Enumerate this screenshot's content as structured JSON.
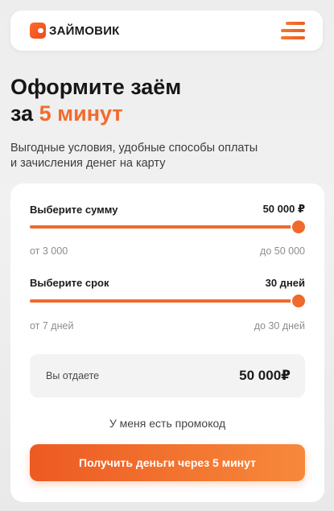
{
  "colors": {
    "accent": "#f26b2b",
    "accent_dark": "#ec4b1c",
    "text": "#1b1b1b",
    "muted": "#8d8d8d",
    "card": "#ffffff",
    "summary_bg": "#f3f3f3"
  },
  "header": {
    "logo_icon": "zaymovik-logo-mark",
    "logo_text": "ЗАЙМОВИК",
    "menu_icon": "hamburger-menu-icon"
  },
  "hero": {
    "title_line1": "Оформите заём",
    "title_prefix": "за",
    "title_accent": "5 минут",
    "subtitle_line1": "Выгодные условия, удобные способы оплаты",
    "subtitle_line2": "и зачисления денег на карту"
  },
  "calculator": {
    "amount": {
      "label": "Выберите сумму",
      "value": "50 000 ₽",
      "min_label": "от 3 000",
      "max_label": "до 50 000",
      "min": 3000,
      "max": 50000,
      "current": 50000
    },
    "term": {
      "label": "Выберите срок",
      "value": "30 дней",
      "min_label": "от 7 дней",
      "max_label": "до 30 дней",
      "min": 7,
      "max": 30,
      "current": 30
    },
    "summary": {
      "label": "Вы отдаете",
      "value": "50 000₽"
    },
    "promo_link": "У меня есть промокод",
    "cta_label": "Получить деньги через 5 минут"
  }
}
